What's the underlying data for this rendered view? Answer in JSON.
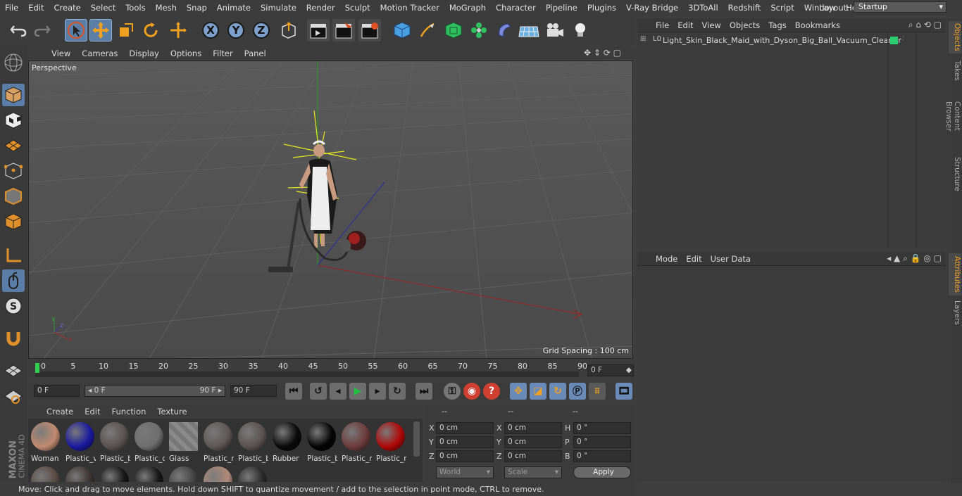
{
  "menubar": {
    "items": [
      "File",
      "Edit",
      "Create",
      "Select",
      "Tools",
      "Mesh",
      "Snap",
      "Animate",
      "Simulate",
      "Render",
      "Sculpt",
      "Motion Tracker",
      "MoGraph",
      "Character",
      "Pipeline",
      "Plugins",
      "V-Ray Bridge",
      "3DToAll",
      "Redshift",
      "Script",
      "Window",
      "Help"
    ],
    "layout_label": "Layout:",
    "layout_value": "Startup"
  },
  "viewport": {
    "menu": [
      "View",
      "Cameras",
      "Display",
      "Options",
      "Filter",
      "Panel"
    ],
    "camera_label": "Perspective",
    "grid_spacing": "Grid Spacing : 100 cm"
  },
  "timeline": {
    "ticks": [
      "0",
      "5",
      "10",
      "15",
      "20",
      "25",
      "30",
      "35",
      "40",
      "45",
      "50",
      "55",
      "60",
      "65",
      "70",
      "75",
      "80",
      "85",
      "90"
    ],
    "current_frame_field": "0 F",
    "start_field": "0 F",
    "range_start": "◂ 0 F",
    "range_end": "90 F ▸",
    "end_field": "90 F"
  },
  "materials": {
    "menu": [
      "Create",
      "Edit",
      "Function",
      "Texture"
    ],
    "row1": [
      {
        "name": "Woman",
        "color": "#c08a70"
      },
      {
        "name": "Plastic_v",
        "color": "#1a1aa0"
      },
      {
        "name": "Plastic_b",
        "color": "#5a5252"
      },
      {
        "name": "Plastic_c",
        "color": "#6e6e6e"
      },
      {
        "name": "Glass",
        "color": "stripe"
      },
      {
        "name": "Plastic_r",
        "color": "#5e5757"
      },
      {
        "name": "Plastic_b",
        "color": "#5a5252"
      },
      {
        "name": "Rubber",
        "color": "#0a0a0a"
      },
      {
        "name": "Plastic_b",
        "color": "#050505"
      },
      {
        "name": "Plastic_r",
        "color": "#6e3c3c"
      },
      {
        "name": "Plastic_r",
        "color": "#b00808"
      }
    ],
    "row2": [
      {
        "name": "",
        "color": "#5a4a44"
      },
      {
        "name": "",
        "color": "#3c3232"
      },
      {
        "name": "",
        "color": "#151515"
      },
      {
        "name": "",
        "color": "#151515"
      },
      {
        "name": "",
        "color": "#444444"
      },
      {
        "name": "",
        "color": "#b08a7a"
      },
      {
        "name": "",
        "color": "#2a2a2a"
      }
    ]
  },
  "coordinates": {
    "headers": [
      "--",
      "--",
      "--"
    ],
    "rows": [
      {
        "l1": "X",
        "v1": "0 cm",
        "l2": "X",
        "v2": "0 cm",
        "l3": "H",
        "v3": "0 °"
      },
      {
        "l1": "Y",
        "v1": "0 cm",
        "l2": "Y",
        "v2": "0 cm",
        "l3": "P",
        "v3": "0 °"
      },
      {
        "l1": "Z",
        "v1": "0 cm",
        "l2": "Z",
        "v2": "0 cm",
        "l3": "B",
        "v3": "0 °"
      }
    ],
    "world": "World",
    "scale": "Scale",
    "apply": "Apply"
  },
  "objects": {
    "menu": [
      "File",
      "Edit",
      "View",
      "Objects",
      "Tags",
      "Bookmarks"
    ],
    "items": [
      {
        "name": "Light_Skin_Black_Maid_with_Dyson_Big_Ball_Vacuum_Cleaner",
        "tag_color": "#2ecc71"
      }
    ]
  },
  "attributes": {
    "menu": [
      "Mode",
      "Edit",
      "User Data"
    ]
  },
  "side_tabs": [
    "Objects",
    "Takes",
    "Content Browser",
    "Structure",
    "Attributes",
    "Layers"
  ],
  "status": "Move: Click and drag to move elements. Hold down SHIFT to quantize movement / add to the selection in point mode, CTRL to remove.",
  "brand": {
    "line1": "MAXON",
    "line2": "CINEMA 4D"
  }
}
